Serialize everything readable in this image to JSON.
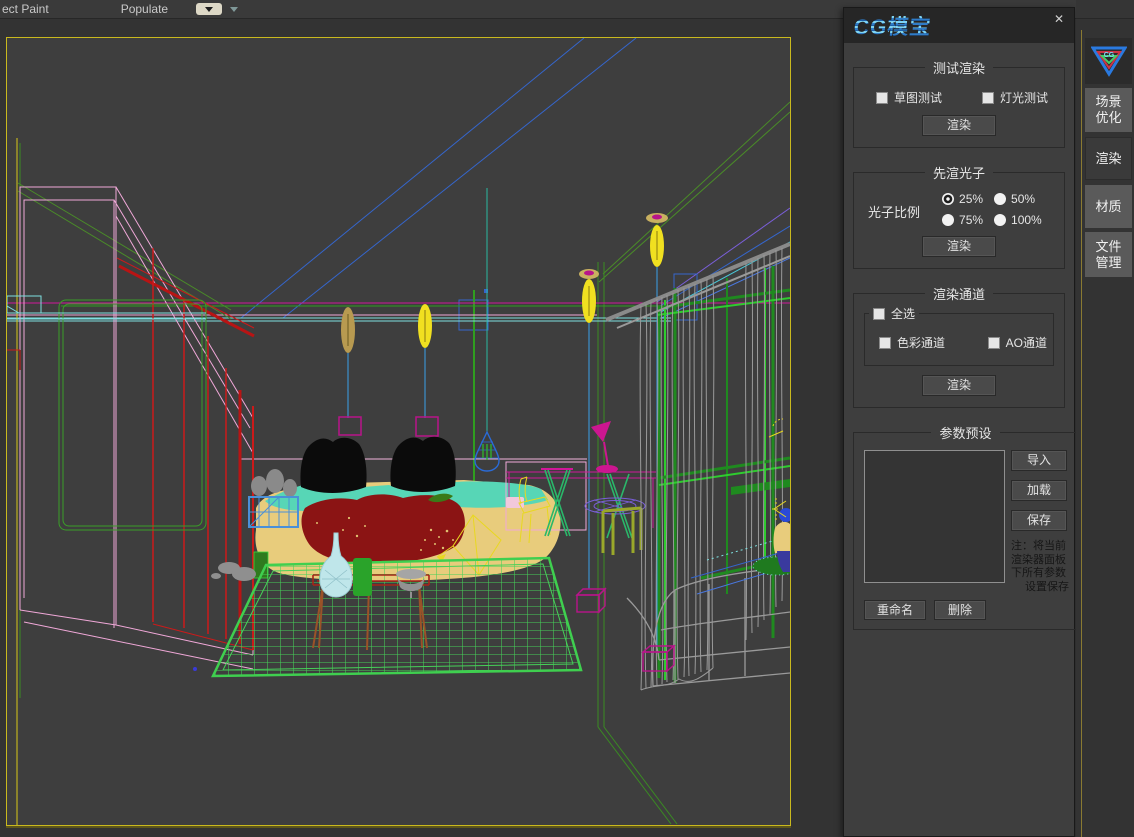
{
  "menu_bar": {
    "items": [
      {
        "label": "ect Paint"
      },
      {
        "label": "Populate"
      }
    ],
    "flyout_icon": "dropdown-arrow"
  },
  "panel": {
    "title": "CG模宝",
    "close": "✕",
    "accent_color": "#3a9ae0",
    "groups": {
      "test_render": {
        "title": "测试渲染",
        "checkboxes": [
          "草图测试",
          "灯光测试"
        ],
        "render_button": "渲染"
      },
      "photon": {
        "title": "先渲光子",
        "label": "光子比例",
        "options": [
          "25%",
          "50%",
          "75%",
          "100%"
        ],
        "selected": "25%",
        "render_button": "渲染"
      },
      "channels": {
        "title": "渲染通道",
        "select_all": "全选",
        "checkboxes": [
          "色彩通道",
          "AO通道"
        ],
        "render_button": "渲染"
      },
      "presets": {
        "title": "参数预设",
        "buttons": [
          "导入",
          "加载",
          "保存"
        ],
        "note_lines": [
          "注：将当前",
          "渲染器面板",
          "下所有参数",
          "设置保存"
        ],
        "rename_button": "重命名",
        "delete_button": "删除"
      }
    }
  },
  "sidebar": {
    "logo": "CG",
    "tabs": [
      {
        "label": "场景优化",
        "active": false
      },
      {
        "label": "渲染",
        "active": true
      },
      {
        "label": "材质",
        "active": false
      },
      {
        "label": "文件管理",
        "active": false
      }
    ]
  },
  "viewport": {
    "border_color": "#c9b91e",
    "background": "#3e3e3e",
    "content": "wireframe-bedroom-scene"
  }
}
